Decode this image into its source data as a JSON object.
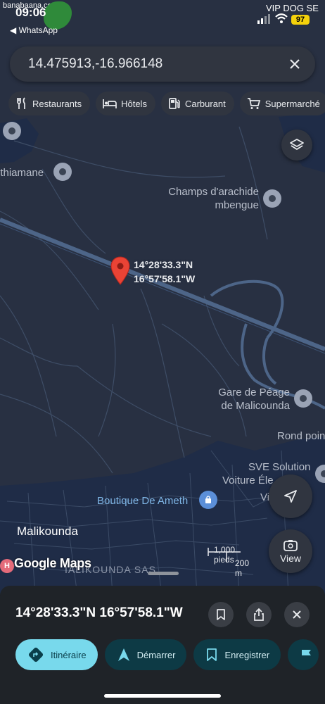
{
  "status_bar": {
    "time": "09:06",
    "back_app": "◀ WhatsApp",
    "carrier": "VIP DOG SE",
    "battery": "97"
  },
  "watermark": "banabaana.com",
  "search": {
    "value": "14.475913,-16.966148",
    "placeholder": ""
  },
  "chips": [
    {
      "label": "Restaurants",
      "icon": "fork-knife-icon"
    },
    {
      "label": "Hôtels",
      "icon": "bed-icon"
    },
    {
      "label": "Carburant",
      "icon": "fuel-icon"
    },
    {
      "label": "Supermarché",
      "icon": "cart-icon"
    }
  ],
  "map": {
    "pin_coords": [
      "14°28'33.3\"N",
      "16°57'58.1\"W"
    ],
    "labels": {
      "thiamane": "nthiamane",
      "champs_1": "Champs d'arachide",
      "champs_2": "mbengue",
      "gare_1": "Gare de Péage",
      "gare_2": "de Malicounda",
      "rond_point": "Rond poin",
      "sve_1": "SVE Solution",
      "sve_2": "Voiture Éle",
      "vil": "Vil",
      "boutique": "Boutique De Ameth",
      "malikounda": "Malikounda",
      "malikounda_sas": "IALIKOUNDA SAS",
      "hospital": "H"
    },
    "logo": "Google Maps",
    "scale": {
      "imperial": "1,000 pieds",
      "metric": "200 m"
    },
    "view_label": "View",
    "colors": {
      "land": "#283042",
      "water_dark": "#1f2c47",
      "road": "#4d6588",
      "pin": "#ea4335"
    }
  },
  "sheet": {
    "title": "14°28'33.3\"N 16°57'58.1\"W",
    "actions": [
      {
        "label": "Itinéraire",
        "icon": "directions-icon"
      },
      {
        "label": "Démarrer",
        "icon": "navigation-arrow-icon"
      },
      {
        "label": "Enregistrer",
        "icon": "bookmark-icon"
      },
      {
        "label": "",
        "icon": "flag-icon"
      }
    ],
    "accent": "#78d9ec"
  }
}
